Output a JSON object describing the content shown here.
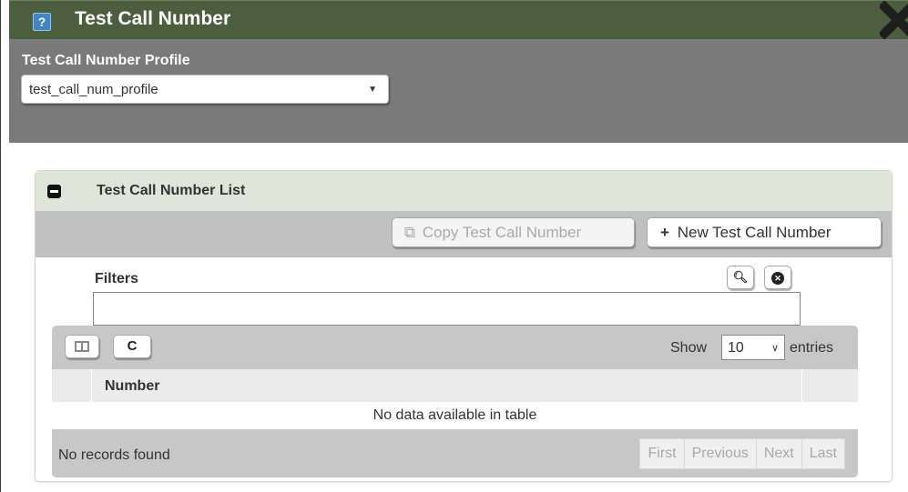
{
  "dialog": {
    "title": "Test Call Number",
    "help_icon": "?"
  },
  "profile": {
    "label": "Test Call Number Profile",
    "selected": "test_call_num_profile"
  },
  "list_panel": {
    "title": "Test Call Number List",
    "toolbar": {
      "copy_label": "Copy Test Call Number",
      "new_label": "New Test Call Number"
    },
    "filters": {
      "label": "Filters",
      "value": ""
    },
    "table": {
      "show_label": "Show",
      "page_size": "10",
      "entries_label": "entries",
      "columns": [
        "Number"
      ],
      "empty_message": "No data available in table",
      "info": "No records found",
      "pagination": [
        "First",
        "Previous",
        "Next",
        "Last"
      ]
    }
  },
  "colors": {
    "titlebar": "#4b5f3f",
    "profile_panel": "#7a7a7a",
    "panel_header": "#dfe5d8",
    "toolbar": "#c0c0c0"
  }
}
